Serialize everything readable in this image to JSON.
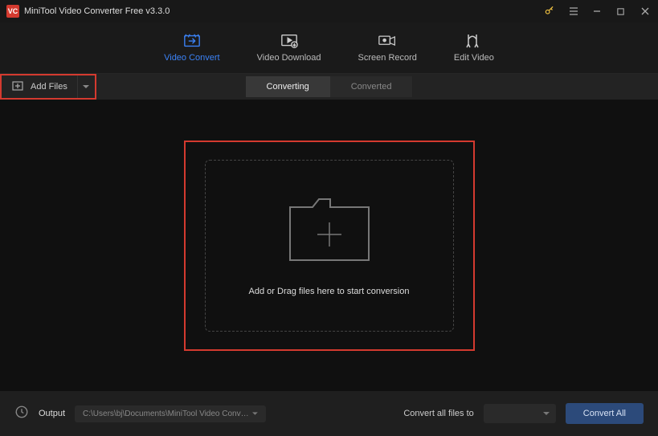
{
  "titlebar": {
    "title": "MiniTool Video Converter Free v3.3.0",
    "logo_text": "VC"
  },
  "tabs": {
    "video_convert": "Video Convert",
    "video_download": "Video Download",
    "screen_record": "Screen Record",
    "edit_video": "Edit Video"
  },
  "toolbar": {
    "add_files": "Add Files"
  },
  "subtabs": {
    "converting": "Converting",
    "converted": "Converted"
  },
  "dropzone": {
    "text": "Add or Drag files here to start conversion"
  },
  "footer": {
    "output_label": "Output",
    "output_path": "C:\\Users\\bj\\Documents\\MiniTool Video Converter\\output",
    "convert_all_label": "Convert all files to",
    "convert_all_btn": "Convert All"
  }
}
